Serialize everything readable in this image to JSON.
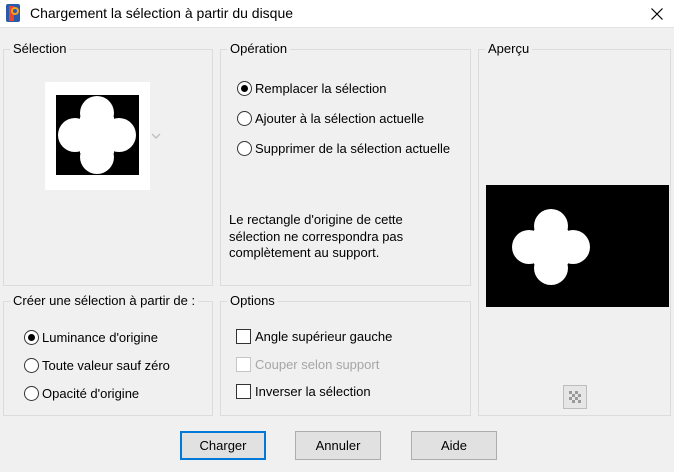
{
  "window": {
    "title": "Chargement la sélection à partir du disque"
  },
  "selection_group": {
    "label": "Sélection"
  },
  "operation_group": {
    "label": "Opération",
    "options": [
      {
        "label": "Remplacer la sélection",
        "checked": true
      },
      {
        "label": "Ajouter à la sélection actuelle",
        "checked": false
      },
      {
        "label": "Supprimer de la sélection actuelle",
        "checked": false
      }
    ],
    "note": "Le rectangle d'origine de cette sélection ne correspondra pas complètement au support."
  },
  "preview_group": {
    "label": "Aperçu"
  },
  "create_group": {
    "label": "Créer une sélection à partir de :",
    "options": [
      {
        "label": "Luminance d'origine",
        "checked": true
      },
      {
        "label": "Toute valeur sauf zéro",
        "checked": false
      },
      {
        "label": "Opacité d'origine",
        "checked": false
      }
    ]
  },
  "options_group": {
    "label": "Options",
    "options": [
      {
        "label": "Angle supérieur gauche",
        "checked": false,
        "enabled": true
      },
      {
        "label": "Couper selon support",
        "checked": false,
        "enabled": false
      },
      {
        "label": "Inverser la sélection",
        "checked": false,
        "enabled": true
      }
    ]
  },
  "buttons": {
    "load": "Charger",
    "cancel": "Annuler",
    "help": "Aide"
  },
  "icons": {
    "app": "paint-shop-pro-icon",
    "close": "close-icon",
    "dropdown": "chevron-down-icon",
    "zoom": "checkerboard-icon"
  },
  "colors": {
    "accent": "#0078d7",
    "title_bg": "#ffffff",
    "dialog_bg": "#f0f0f0"
  }
}
